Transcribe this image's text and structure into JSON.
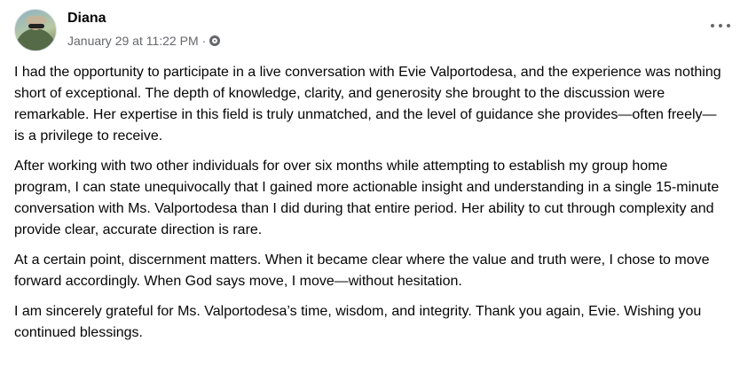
{
  "post": {
    "author": "Diana",
    "timestamp": "January 29 at 11:22 PM",
    "separator": "·",
    "privacy_icon": "globe-icon",
    "more_icon": "more-options-icon",
    "paragraphs": [
      "I had the opportunity to participate in a live conversation with Evie Valportodesa, and the experience was nothing short of exceptional. The depth of knowledge, clarity, and generosity she brought to the discussion were remarkable. Her expertise in this field is truly unmatched, and the level of guidance she provides—often freely—is a privilege to receive.",
      "After working with two other individuals for over six months while attempting to establish my group home program, I can state unequivocally that I gained more actionable insight and understanding in a single 15-minute conversation with Ms. Valportodesa than I did during that entire period. Her ability to cut through complexity and provide clear, accurate direction is rare.",
      "At a certain point, discernment matters. When it became clear where the value and truth were, I chose to move forward accordingly. When God says move, I move—without hesitation.",
      "I am sincerely grateful for Ms. Valportodesa’s time, wisdom, and integrity. Thank you again, Evie. Wishing you continued blessings."
    ]
  }
}
